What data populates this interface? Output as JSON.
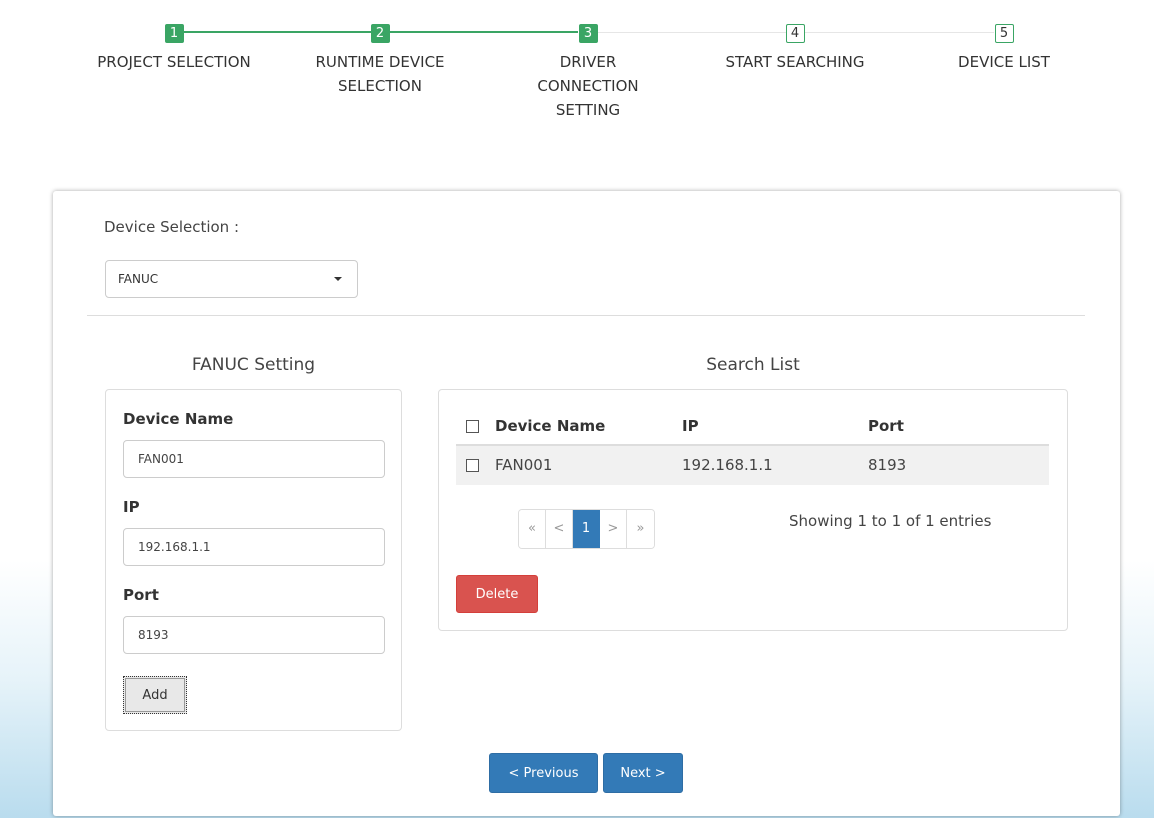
{
  "steps": [
    {
      "number": "1",
      "label": "PROJECT SELECTION"
    },
    {
      "number": "2",
      "label": "RUNTIME DEVICE SELECTION"
    },
    {
      "number": "3",
      "label": "DRIVER CONNECTION SETTING"
    },
    {
      "number": "4",
      "label": "START SEARCHING"
    },
    {
      "number": "5",
      "label": "DEVICE LIST"
    }
  ],
  "current_step": 3,
  "device_selection": {
    "label": "Device Selection :",
    "selected": "FANUC"
  },
  "setting": {
    "title": "FANUC Setting",
    "device_name_label": "Device Name",
    "device_name_value": "FAN001",
    "ip_label": "IP",
    "ip_value": "192.168.1.1",
    "port_label": "Port",
    "port_value": "8193",
    "add_label": "Add"
  },
  "search_list": {
    "title": "Search List",
    "columns": [
      "Device Name",
      "IP",
      "Port"
    ],
    "rows": [
      {
        "name": "FAN001",
        "ip": "192.168.1.1",
        "port": "8193"
      }
    ],
    "pagination": {
      "first": "«",
      "prev": "<",
      "current": "1",
      "next": ">",
      "last": "»"
    },
    "showing": "Showing 1 to 1 of 1 entries",
    "delete_label": "Delete"
  },
  "nav": {
    "previous_label": "< Previous",
    "next_label": "Next >"
  },
  "colors": {
    "step_done": "#3aa564",
    "primary": "#337ab7",
    "danger": "#d9534f"
  }
}
